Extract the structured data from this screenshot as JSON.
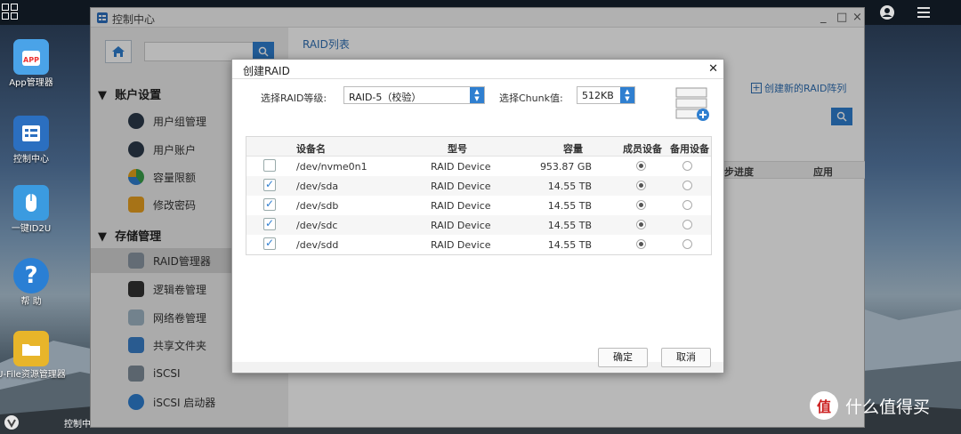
{
  "desktop": {
    "icons": [
      {
        "label": "App管理器"
      },
      {
        "label": "控制中心"
      },
      {
        "label": "一键ID2U"
      },
      {
        "label": "帮 助"
      },
      {
        "label": "U-File资源管理器"
      }
    ],
    "taskbar_label": "控制中"
  },
  "window": {
    "title": "控制中心",
    "controls": [
      "_",
      "□",
      "×"
    ],
    "sidebar": {
      "groups": [
        {
          "label": "账户设置",
          "items": [
            {
              "label": "用户组管理",
              "icon": "users-group-icon"
            },
            {
              "label": "用户账户",
              "icon": "user-icon"
            },
            {
              "label": "容量限额",
              "icon": "quota-icon"
            },
            {
              "label": "修改密码",
              "icon": "lock-icon"
            }
          ]
        },
        {
          "label": "存储管理",
          "items": [
            {
              "label": "RAID管理器",
              "icon": "raid-icon"
            },
            {
              "label": "逻辑卷管理",
              "icon": "volume-icon"
            },
            {
              "label": "网络卷管理",
              "icon": "network-volume-icon"
            },
            {
              "label": "共享文件夹",
              "icon": "share-folder-icon"
            },
            {
              "label": "iSCSI",
              "icon": "iscsi-icon"
            },
            {
              "label": "iSCSI 启动器",
              "icon": "iscsi-initiator-icon"
            }
          ]
        }
      ]
    },
    "main": {
      "title": "RAID列表",
      "create_link": "创建新的RAID阵列",
      "columns_visible": [
        "步进度",
        "应用"
      ]
    }
  },
  "dialog": {
    "title": "创建RAID",
    "raid_level_label": "选择RAID等级:",
    "raid_level_value": "RAID-5（校验）",
    "chunk_label": "选择Chunk值:",
    "chunk_value": "512KB",
    "table": {
      "headers": [
        "设备名",
        "型号",
        "容量",
        "成员设备",
        "备用设备"
      ],
      "rows": [
        {
          "checked": false,
          "device": "/dev/nvme0n1",
          "model": "RAID Device",
          "capacity": "953.87 GB",
          "member": true,
          "spare": false
        },
        {
          "checked": true,
          "device": "/dev/sda",
          "model": "RAID Device",
          "capacity": "14.55 TB",
          "member": true,
          "spare": false
        },
        {
          "checked": true,
          "device": "/dev/sdb",
          "model": "RAID Device",
          "capacity": "14.55 TB",
          "member": true,
          "spare": false
        },
        {
          "checked": true,
          "device": "/dev/sdc",
          "model": "RAID Device",
          "capacity": "14.55 TB",
          "member": true,
          "spare": false
        },
        {
          "checked": true,
          "device": "/dev/sdd",
          "model": "RAID Device",
          "capacity": "14.55 TB",
          "member": true,
          "spare": false
        }
      ]
    },
    "ok_label": "确定",
    "cancel_label": "取消"
  },
  "watermark": {
    "mark": "值",
    "text": "什么值得买"
  }
}
